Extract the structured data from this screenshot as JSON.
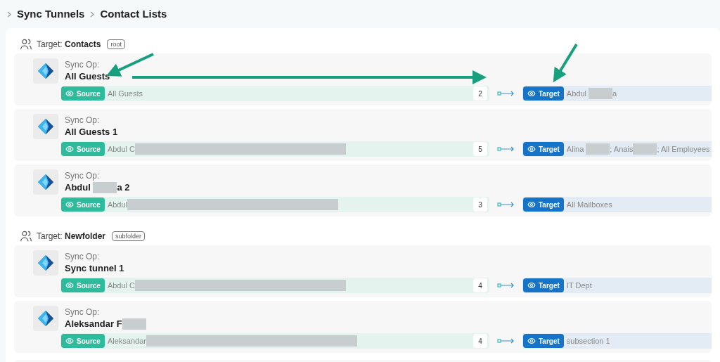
{
  "breadcrumb": [
    {
      "label": "Sync Tunnels"
    },
    {
      "label": "Contact Lists"
    }
  ],
  "groups": [
    {
      "prefix": "Target:",
      "name": "Contacts",
      "tag": "root",
      "ops": [
        {
          "label": "Sync Op:",
          "name": [
            {
              "kind": "text",
              "text": "All Guests"
            }
          ],
          "source_button": "Source",
          "source": [
            {
              "kind": "text",
              "text": "All Guests"
            }
          ],
          "count": "2",
          "target_button": "Target",
          "target": [
            {
              "kind": "text",
              "text": "Abdul "
            },
            {
              "kind": "redacted"
            },
            {
              "kind": "text",
              "text": "a"
            }
          ]
        },
        {
          "label": "Sync Op:",
          "name": [
            {
              "kind": "text",
              "text": "All Guests 1"
            }
          ],
          "source_button": "Source",
          "source": [
            {
              "kind": "text",
              "text": "Abdul C"
            },
            {
              "kind": "redacted"
            }
          ],
          "count": "5",
          "target_button": "Target",
          "target": [
            {
              "kind": "text",
              "text": "Alina "
            },
            {
              "kind": "redacted"
            },
            {
              "kind": "text",
              "text": "; Anais"
            },
            {
              "kind": "redacted"
            },
            {
              "kind": "text",
              "text": "; All Employees"
            }
          ]
        },
        {
          "label": "Sync Op:",
          "name": [
            {
              "kind": "text",
              "text": "Abdul "
            },
            {
              "kind": "redacted"
            },
            {
              "kind": "text",
              "text": "a 2"
            }
          ],
          "source_button": "Source",
          "source": [
            {
              "kind": "text",
              "text": "Abdul"
            },
            {
              "kind": "redacted"
            }
          ],
          "count": "3",
          "target_button": "Target",
          "target": [
            {
              "kind": "text",
              "text": "All Mailboxes"
            }
          ]
        }
      ]
    },
    {
      "prefix": "Target:",
      "name": "Newfolder",
      "tag": "subfolder",
      "ops": [
        {
          "label": "Sync Op:",
          "name": [
            {
              "kind": "text",
              "text": "Sync tunnel 1"
            }
          ],
          "source_button": "Source",
          "source": [
            {
              "kind": "text",
              "text": "Abdul C"
            },
            {
              "kind": "redacted"
            }
          ],
          "count": "4",
          "target_button": "Target",
          "target": [
            {
              "kind": "text",
              "text": "IT Dept"
            }
          ]
        },
        {
          "label": "Sync Op:",
          "name": [
            {
              "kind": "text",
              "text": "Aleksandar F"
            },
            {
              "kind": "redacted"
            }
          ],
          "source_button": "Source",
          "source": [
            {
              "kind": "text",
              "text": "Aleksandar"
            },
            {
              "kind": "redacted"
            }
          ],
          "count": "4",
          "target_button": "Target",
          "target": [
            {
              "kind": "text",
              "text": "subsection 1"
            }
          ]
        }
      ]
    }
  ],
  "annotations": [
    {
      "kind": "arrow"
    },
    {
      "kind": "arrow"
    },
    {
      "kind": "arrow"
    }
  ]
}
